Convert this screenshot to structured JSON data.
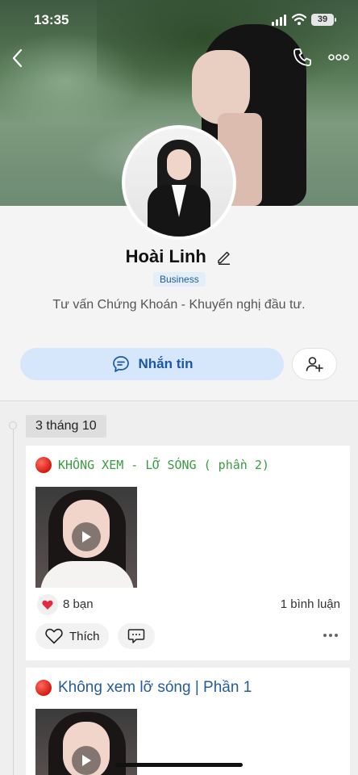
{
  "status_bar": {
    "time": "13:35",
    "battery": "39"
  },
  "profile": {
    "name": "Hoài Linh",
    "badge": "Business",
    "bio": "Tư vấn Chứng Khoán - Khuyến nghị đầu tư.",
    "message_label": "Nhắn tin"
  },
  "timeline": {
    "date": "3 tháng 10"
  },
  "posts": [
    {
      "title": "KHÔNG XEM - LỠ SÓNG ( phần 2)",
      "reactions": "8 bạn",
      "comments": "1 bình luận",
      "like_label": "Thích"
    },
    {
      "title": "Không xem lỡ sóng | Phần 1"
    }
  ],
  "icons": {
    "back": "chevron-left-icon",
    "call": "phone-icon",
    "more": "more-horizontal-icon",
    "edit": "pencil-icon",
    "message": "chat-bubble-icon",
    "add_friend": "add-user-icon",
    "heart": "heart-icon",
    "play": "play-icon"
  },
  "colors": {
    "accent": "#1c57a6",
    "message_button_bg": "#d6e7fb",
    "badge_text": "#205e92",
    "post1_title": "#3c9a43",
    "post2_title": "#245c99",
    "reaction_heart": "#e5293f"
  }
}
